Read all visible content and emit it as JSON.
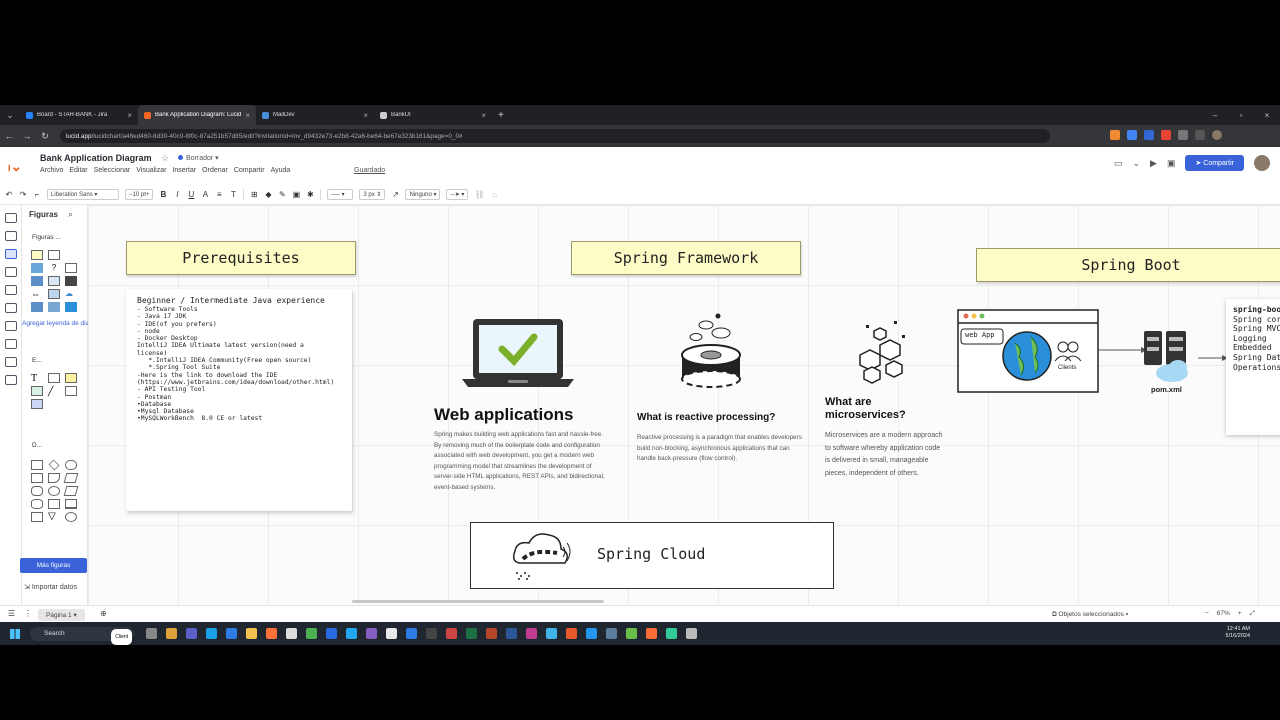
{
  "browser": {
    "tabs": [
      {
        "title": "Board - STAR-BANK - Jira",
        "color": "#2684ff"
      },
      {
        "title": "Bank Application Diagram: Lucid",
        "color": "#f26522"
      },
      {
        "title": "MailDev",
        "color": "#4a90d9"
      },
      {
        "title": "BankUI",
        "color": "#cccccc"
      }
    ],
    "url_host": "lucid.app",
    "url_path": "/lucidchart/a46ed460-8d30-40c0-8f0c-87a251b57d85/edit?invitationId=inv_d9432e73-e2b8-42a6-be64-be67e323b161&page=0_0#"
  },
  "header": {
    "doc_title": "Bank Application Diagram",
    "status": "Borrador",
    "menu": [
      "Archivo",
      "Editar",
      "Seleccionar",
      "Visualizar",
      "Insertar",
      "Ordenar",
      "Compartir",
      "Ayuda"
    ],
    "saved": "Guardado",
    "share": "Compartir"
  },
  "toolbar": {
    "font": "Liberation Sans",
    "size": "10 pt",
    "line_width": "3 px",
    "arrow_start": "Ninguno"
  },
  "panel": {
    "title": "Figuras",
    "section1": "Figuras ...",
    "legend_link": "Agregar leyenda de diagrama",
    "section2": "E...",
    "section3": "D...",
    "more": "Más figuras",
    "import": "Importar datos"
  },
  "canvas": {
    "prereq_title": "Prerequisites",
    "prereq_lines": [
      "Beginner / Intermediate Java experience",
      "- Software Tools",
      "- Java 17 JDK",
      "- IDE(of you prefers)",
      "- node",
      "- Docker Desktop",
      "IntelliJ IDEA Ultimate latest version(need a",
      "license)",
      "   *.IntelliJ IDEA Community(Free open source)",
      "   *.Spring Tool Suite",
      "-Here is the link to download the IDE",
      "(https://www.jetbrains.com/idea/download/other.html)",
      "- API Testing Tool",
      "- Postman",
      "•Database",
      "•Mysql Database",
      "•MySQLWorkBench  8.0 CE or latest"
    ],
    "spring_fw_title": "Spring Framework",
    "spring_boot_title": "Spring Boot",
    "web_apps_title": "Web applications",
    "web_apps_body": "Spring makes building web applications fast and hassle-free. By removing much of the boilerplate code and configuration associated with web development, you get a modern web programming model that streamlines the development of server-side HTML applications, REST APIs, and bidirectional, event-based systems.",
    "reactive_title": "What is reactive processing?",
    "reactive_body": "Reactive processing is a paradigm that enables developers build non-blocking, asynchronous applications that can handle back-pressure (flow control).",
    "micro_title": "What are microservices?",
    "micro_body": "Microservices are a modern approach to software whereby application code is delivered in small, manageable pieces, independent of others.",
    "web_app_label": "web App",
    "clients_label": "Clients",
    "pom_label": "pom.xml",
    "spring_cloud_title": "Spring Cloud",
    "boot_panel_title": "spring-boot",
    "boot_panel_lines": [
      "Spring core",
      "Spring MVC",
      "Logging",
      "Embedded",
      "Spring Data",
      "Operations"
    ]
  },
  "bottom": {
    "page": "Página 1",
    "selected": "Objetos seleccionados",
    "zoom": "67%"
  },
  "taskbar": {
    "search": "Search",
    "pill": "Client",
    "time": "12:41 AM",
    "date": "5/16/2024"
  }
}
